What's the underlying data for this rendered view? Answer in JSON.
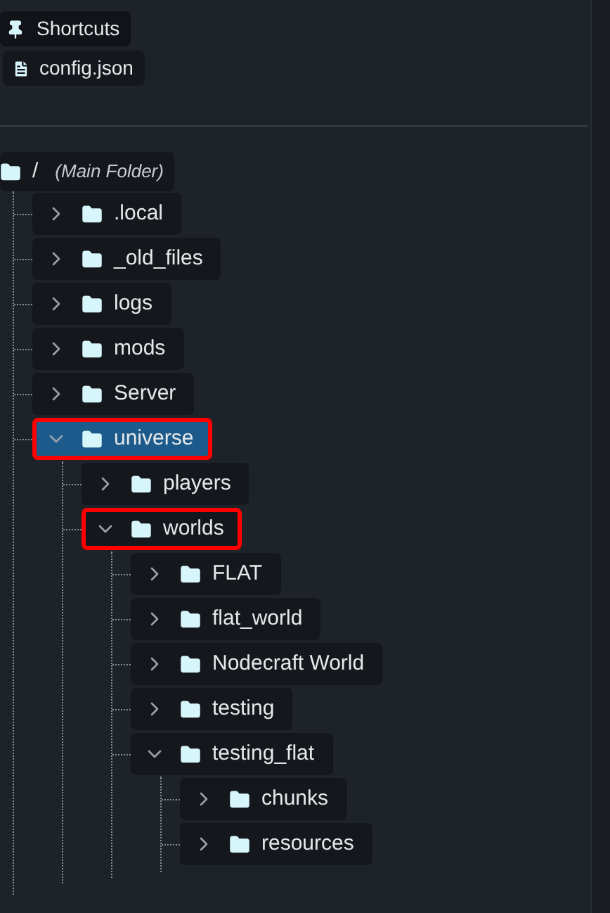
{
  "shortcuts": {
    "title": "Shortcuts",
    "files": [
      {
        "name": "config.json"
      }
    ]
  },
  "tree": {
    "name": "/",
    "note": "(Main Folder)",
    "children": [
      {
        "name": ".local",
        "expanded": false,
        "selected": false,
        "highlighted": false
      },
      {
        "name": "_old_files",
        "expanded": false,
        "selected": false,
        "highlighted": false
      },
      {
        "name": "logs",
        "expanded": false,
        "selected": false,
        "highlighted": false
      },
      {
        "name": "mods",
        "expanded": false,
        "selected": false,
        "highlighted": false
      },
      {
        "name": "Server",
        "expanded": false,
        "selected": false,
        "highlighted": false
      },
      {
        "name": "universe",
        "expanded": true,
        "selected": true,
        "highlighted": true,
        "children": [
          {
            "name": "players",
            "expanded": false,
            "selected": false,
            "highlighted": false
          },
          {
            "name": "worlds",
            "expanded": true,
            "selected": false,
            "highlighted": true,
            "children": [
              {
                "name": "FLAT",
                "expanded": false,
                "selected": false,
                "highlighted": false
              },
              {
                "name": "flat_world",
                "expanded": false,
                "selected": false,
                "highlighted": false
              },
              {
                "name": "Nodecraft World",
                "expanded": false,
                "selected": false,
                "highlighted": false
              },
              {
                "name": "testing",
                "expanded": false,
                "selected": false,
                "highlighted": false
              },
              {
                "name": "testing_flat",
                "expanded": true,
                "selected": false,
                "highlighted": false,
                "children": [
                  {
                    "name": "chunks",
                    "expanded": false,
                    "selected": false,
                    "highlighted": false
                  },
                  {
                    "name": "resources",
                    "expanded": false,
                    "selected": false,
                    "highlighted": false
                  }
                ]
              }
            ]
          }
        ]
      }
    ]
  }
}
